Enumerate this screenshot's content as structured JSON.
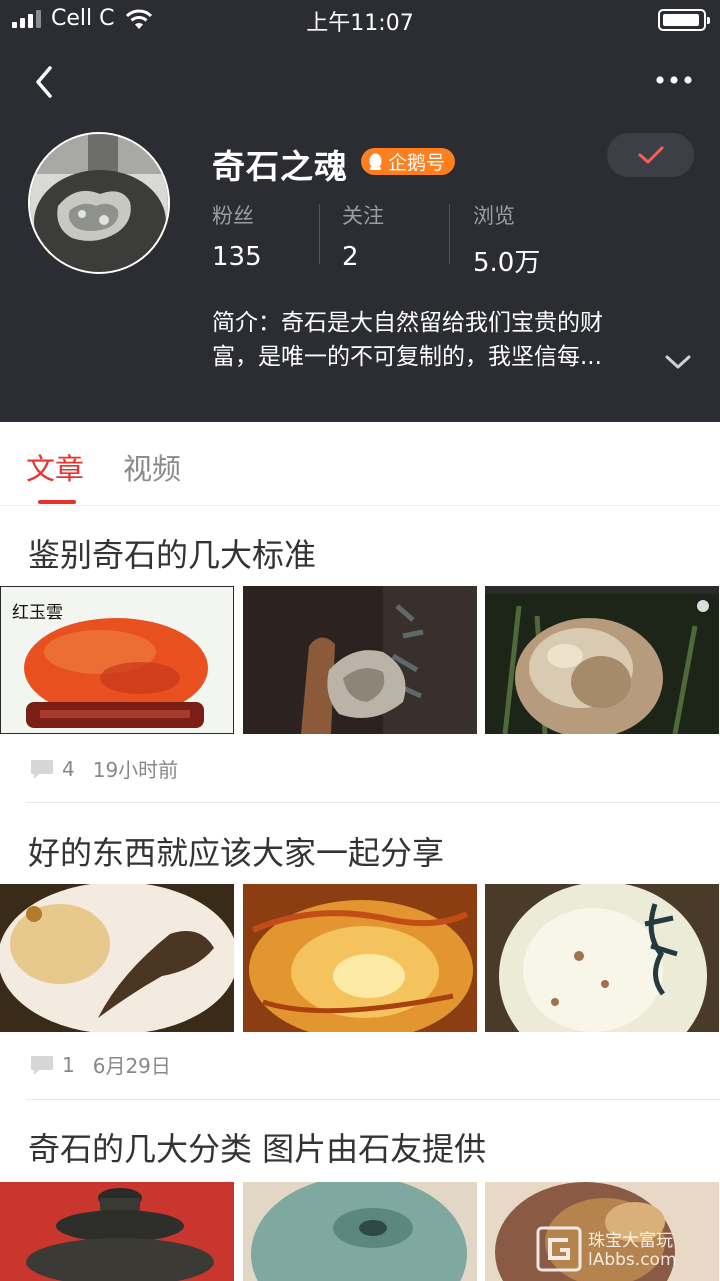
{
  "status_bar": {
    "carrier": "Cell C",
    "time": "上午11:07"
  },
  "nav": {
    "back_icon": "chevron-left-icon",
    "more_icon": "more-dots-icon"
  },
  "profile": {
    "name": "奇石之魂",
    "badge": "企鹅号",
    "followed": true,
    "stats": [
      {
        "label": "粉丝",
        "value": "135"
      },
      {
        "label": "关注",
        "value": "2"
      },
      {
        "label": "浏览",
        "value": "5.0万"
      }
    ],
    "bio_line1": "简介：奇石是大自然留给我们宝贵的财",
    "bio_line2": "富，是唯一的不可复制的，我坚信每..."
  },
  "tabs": [
    {
      "label": "文章",
      "active": true
    },
    {
      "label": "视频",
      "active": false
    }
  ],
  "articles": [
    {
      "title": "鉴别奇石的几大标准",
      "thumb_label": "红玉雲",
      "comments": "4",
      "time": "19小时前"
    },
    {
      "title": "好的东西就应该大家一起分享",
      "comments": "1",
      "time": "6月29日"
    },
    {
      "title": "奇石的几大分类 图片由石友提供"
    }
  ],
  "watermark": {
    "line1": "珠宝大富玩",
    "line2": "lAbbs.com"
  },
  "colors": {
    "header_bg": "#2b2d33",
    "accent_red": "#e8322b",
    "badge_orange": "#ff7f1f"
  }
}
